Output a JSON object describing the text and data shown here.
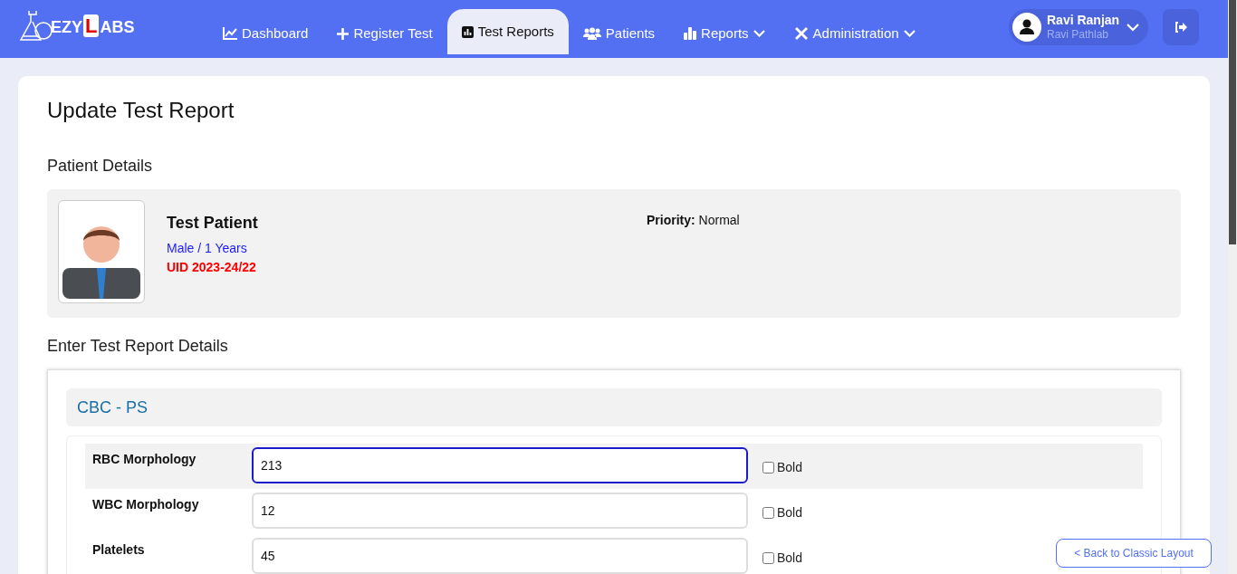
{
  "logo": {
    "text_before": "EZY",
    "highlight": "L",
    "text_after": "ABS"
  },
  "nav": [
    {
      "label": "Dashboard",
      "selected": false,
      "dropdown": false
    },
    {
      "label": "Register Test",
      "selected": false,
      "dropdown": false
    },
    {
      "label": "Test Reports",
      "selected": true,
      "dropdown": false
    },
    {
      "label": "Patients",
      "selected": false,
      "dropdown": false
    },
    {
      "label": "Reports",
      "selected": false,
      "dropdown": true
    },
    {
      "label": "Administration",
      "selected": false,
      "dropdown": true
    }
  ],
  "user": {
    "name": "Ravi Ranjan",
    "lab": "Ravi Pathlab"
  },
  "page_title": "Update Test Report",
  "patient_section_title": "Patient Details",
  "patient": {
    "name": "Test Patient",
    "gender_age": "Male / 1 Years",
    "uid": "UID 2023-24/22",
    "priority_label": "Priority:",
    "priority": "Normal"
  },
  "report_section_title": "Enter Test Report Details",
  "test_name": "CBC - PS",
  "rows": [
    {
      "label": "RBC Morphology",
      "value": "213",
      "selected": true,
      "bold_label": "Bold",
      "checked": false
    },
    {
      "label": "WBC Morphology",
      "value": "12",
      "selected": false,
      "bold_label": "Bold",
      "checked": false
    },
    {
      "label": "Platelets",
      "value": "45",
      "selected": false,
      "bold_label": "Bold",
      "checked": false
    }
  ],
  "back_link": "< Back to Classic Layout"
}
